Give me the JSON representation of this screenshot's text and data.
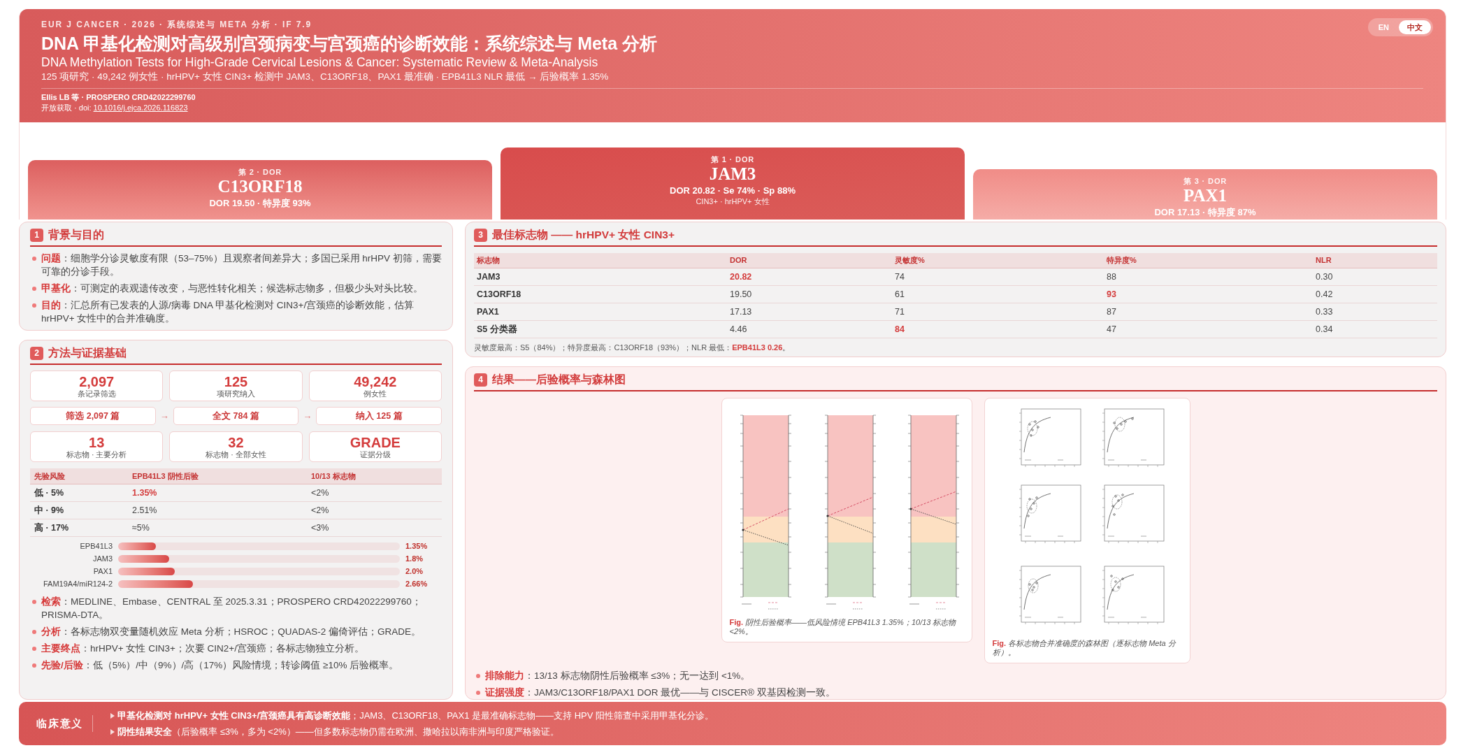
{
  "header": {
    "kicker": "EUR J CANCER · 2026 · 系统综述与 META 分析 · IF 7.9",
    "title": "DNA 甲基化检测对高级别宫颈病变与宫颈癌的诊断效能：系统综述与 Meta 分析",
    "subtitle": "DNA Methylation Tests for High-Grade Cervical Lesions & Cancer: Systematic Review & Meta-Analysis",
    "summary": "125 项研究 · 49,242 例女性 · hrHPV+ 女性 CIN3+ 检测中 JAM3、C13ORF18、PAX1 最准确 · EPB41L3 NLR 最低 → 后验概率 1.35%",
    "authors": "Ellis LB 等 · PROSPERO CRD42022299760",
    "access": "开放获取 · doi:",
    "doi": "10.1016/j.ejca.2026.116823"
  },
  "language_toggle": [
    {
      "label": "EN",
      "selected": false
    },
    {
      "label": "中文",
      "selected": true
    }
  ],
  "podium": [
    {
      "kind": "second",
      "rank": "第 2 · DOR",
      "marker": "C13ORF18",
      "stats": "DOR 19.50 · 特异度 93%"
    },
    {
      "kind": "first",
      "rank": "第 1 · DOR",
      "marker": "JAM3",
      "stats": "DOR 20.82 · Se 74% · Sp 88%",
      "note": "CIN3+ · hrHPV+ 女性"
    },
    {
      "kind": "third",
      "rank": "第 3 · DOR",
      "marker": "PAX1",
      "stats": "DOR 17.13 · 特异度 87%"
    }
  ],
  "background": {
    "number": "1",
    "title": "背景与目的",
    "bullets": [
      "**问题**：细胞学分诊灵敏度有限（53–75%）且观察者间差异大；多国已采用 hrHPV 初筛，需要可靠的分诊手段。",
      "**甲基化**：可测定的表观遗传改变，与恶性转化相关；候选标志物多，但极少头对头比较。",
      "**目的**：汇总所有已发表的人源/病毒 DNA 甲基化检测对 CIN3+/宫颈癌的诊断效能，估算 hrHPV+ 女性中的合并准确度。"
    ]
  },
  "methods": {
    "number": "2",
    "title": "方法与证据基础",
    "stats_top": [
      {
        "value": "2,097",
        "label": "条记录筛选"
      },
      {
        "value": "125",
        "label": "项研究纳入"
      },
      {
        "value": "49,242",
        "label": "例女性"
      }
    ],
    "flow": [
      {
        "kind": "step",
        "text": "筛选 2,097 篇"
      },
      {
        "kind": "arrow",
        "text": "→"
      },
      {
        "kind": "step",
        "text": "全文 784 篇"
      },
      {
        "kind": "arrow",
        "text": "→"
      },
      {
        "kind": "step",
        "text": "纳入 125 篇"
      }
    ],
    "stats_bottom": [
      {
        "value": "13",
        "label": "标志物 · 主要分析"
      },
      {
        "value": "32",
        "label": "标志物 · 全部女性"
      },
      {
        "value": "GRADE",
        "label": "证据分级"
      }
    ],
    "risk_table": {
      "columns": [
        "先验风险",
        "EPB41L3 阴性后验",
        "10/13 标志物"
      ],
      "rows": [
        {
          "cells": [
            {
              "text": "低 · 5%",
              "highlight": false
            },
            {
              "text": "1.35%",
              "highlight": true
            },
            {
              "text": "<2%",
              "highlight": false
            }
          ]
        },
        {
          "cells": [
            {
              "text": "中 · 9%",
              "highlight": false
            },
            {
              "text": "2.51%",
              "highlight": false
            },
            {
              "text": "<2%",
              "highlight": false
            }
          ]
        },
        {
          "cells": [
            {
              "text": "高 · 17%",
              "highlight": false
            },
            {
              "text": "≈5%",
              "highlight": false
            },
            {
              "text": "<3%",
              "highlight": false
            }
          ]
        }
      ]
    },
    "bars": [
      {
        "label": "EPB41L3",
        "level": 0.135,
        "value": "1.35%"
      },
      {
        "label": "JAM3",
        "level": 0.18,
        "value": "1.8%"
      },
      {
        "label": "PAX1",
        "level": 0.2,
        "value": "2.0%"
      },
      {
        "label": "FAM19A4/miR124-2",
        "level": 0.266,
        "value": "2.66%"
      }
    ],
    "bullets": [
      "**检索**：MEDLINE、Embase、CENTRAL 至 2025.3.31；PROSPERO CRD42022299760；PRISMA-DTA。",
      "**分析**：各标志物双变量随机效应 Meta 分析；HSROC；QUADAS-2 偏倚评估；GRADE。",
      "**主要终点**：hrHPV+ 女性 CIN3+；次要 CIN2+/宫颈癌；各标志物独立分析。",
      "**先验/后验**：低（5%）/中（9%）/高（17%）风险情境；转诊阈值 ≥10% 后验概率。"
    ]
  },
  "best_markers": {
    "number": "3",
    "title": "最佳标志物 —— hrHPV+ 女性 CIN3+",
    "columns": [
      "标志物",
      "DOR",
      "灵敏度%",
      "特异度%",
      "NLR"
    ],
    "rows": [
      {
        "cells": [
          {
            "text": "JAM3",
            "highlight": false
          },
          {
            "text": "20.82",
            "highlight": true
          },
          {
            "text": "74",
            "highlight": false
          },
          {
            "text": "88",
            "highlight": false
          },
          {
            "text": "0.30",
            "highlight": false
          }
        ]
      },
      {
        "cells": [
          {
            "text": "C13ORF18",
            "highlight": false
          },
          {
            "text": "19.50",
            "highlight": false
          },
          {
            "text": "61",
            "highlight": false
          },
          {
            "text": "93",
            "highlight": true
          },
          {
            "text": "0.42",
            "highlight": false
          }
        ]
      },
      {
        "cells": [
          {
            "text": "PAX1",
            "highlight": false
          },
          {
            "text": "17.13",
            "highlight": false
          },
          {
            "text": "71",
            "highlight": false
          },
          {
            "text": "87",
            "highlight": false
          },
          {
            "text": "0.33",
            "highlight": false
          }
        ]
      },
      {
        "cells": [
          {
            "text": "S5 分类器",
            "highlight": false
          },
          {
            "text": "4.46",
            "highlight": false
          },
          {
            "text": "84",
            "highlight": true
          },
          {
            "text": "47",
            "highlight": false
          },
          {
            "text": "0.34",
            "highlight": false
          }
        ]
      }
    ],
    "note": "灵敏度最高：S5（84%）；特异度最高：C13ORF18（93%）；NLR 最低：**EPB41L3 0.26**。"
  },
  "results": {
    "number": "4",
    "title": "结果——后验概率与森林图",
    "figures": [
      {
        "kind": "nomogram",
        "caption": "**Fig.** 阴性后验概率——低风险情境 EPB41L3 1.35%；10/13 标志物 <2%。"
      },
      {
        "kind": "sroc",
        "caption": "**Fig.** 各标志物合并准确度的森林图（逐标志物 Meta 分析）。"
      }
    ],
    "bullets": [
      "**排除能力**：13/13 标志物阴性后验概率 ≤3%；无一达到 <1%。",
      "**证据强度**：JAM3/C13ORF18/PAX1 DOR 最优——与 CISCER® 双基因检测一致。"
    ]
  },
  "footer": {
    "title": "临床意义",
    "points": [
      "**甲基化检测对 hrHPV+ 女性 CIN3+/宫颈癌具有高诊断效能**；JAM3、C13ORF18、PAX1 是最准确标志物——支持 HPV 阳性筛查中采用甲基化分诊。",
      "**阴性结果安全**（后验概率 ≤3%，多为 <2%）——但多数标志物仍需在欧洲、撒哈拉以南非洲与印度严格验证。"
    ]
  }
}
